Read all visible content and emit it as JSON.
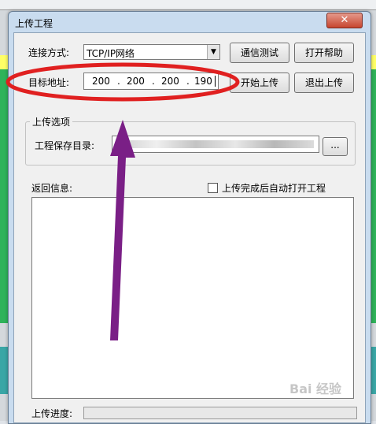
{
  "dialog": {
    "title": "上传工程",
    "close_label": "✕"
  },
  "connection": {
    "label": "连接方式:",
    "selected": "TCP/IP网络",
    "test_button": "通信测试",
    "help_button": "打开帮助"
  },
  "target": {
    "label": "目标地址:",
    "ip": [
      "200",
      "200",
      "200",
      "190"
    ],
    "start_button": "开始上传",
    "exit_button": "退出上传"
  },
  "upload_options": {
    "group_title": "上传选项",
    "save_dir_label": "工程保存目录:",
    "save_dir_value": "D:\\程序\\...",
    "browse_button": "..."
  },
  "feedback": {
    "label": "返回信息:",
    "auto_open_label": "上传完成后自动打开工程",
    "auto_open_checked": false
  },
  "progress": {
    "label": "上传进度:",
    "value": 0
  },
  "annotation": {
    "ellipse_color": "#e02020",
    "arrow_color": "#7a1f86"
  },
  "watermark": "Bai 经验"
}
